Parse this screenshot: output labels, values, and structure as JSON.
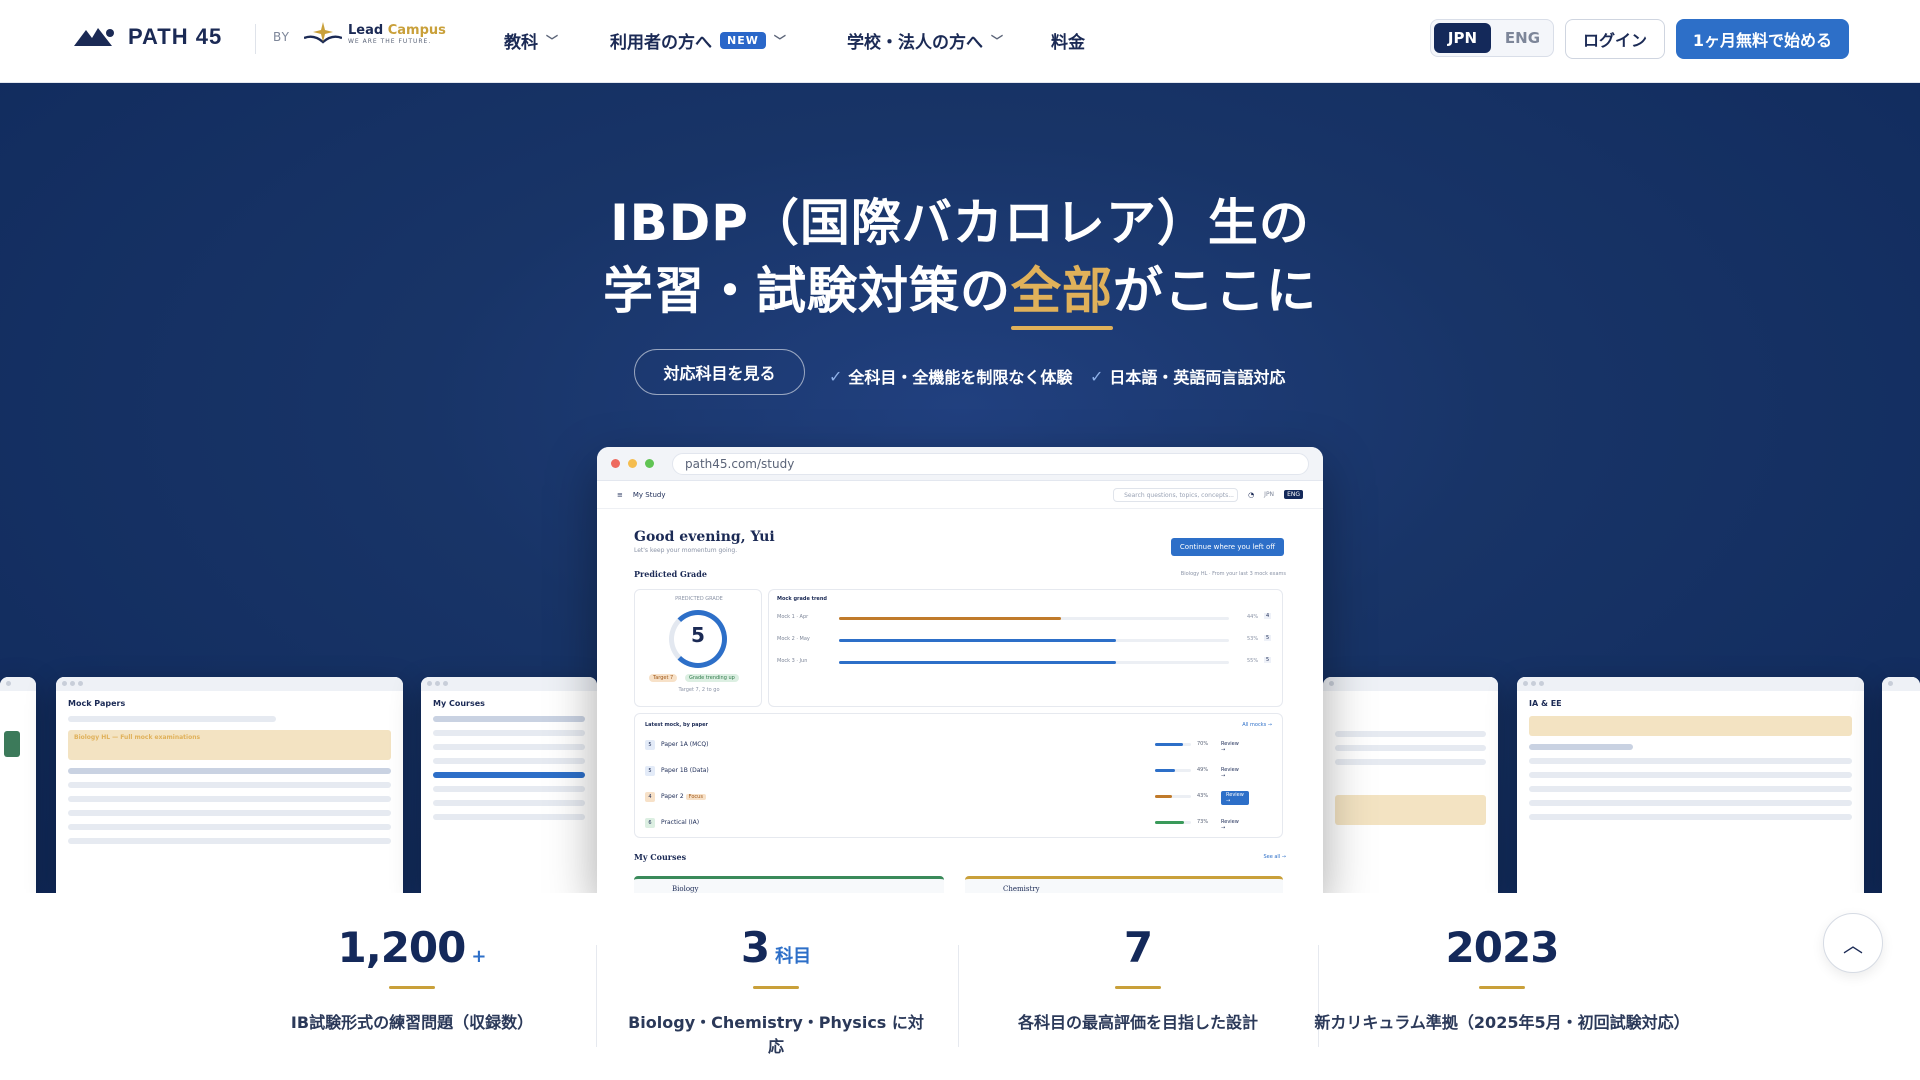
{
  "header": {
    "brand": "PATH 45",
    "by": "BY",
    "partner_line1a": "Lead",
    "partner_line1b": "Campus",
    "partner_line2": "WE ARE THE FUTURE.",
    "nav": [
      {
        "label": "教科"
      },
      {
        "label": "利用者の方へ",
        "badge": "NEW"
      },
      {
        "label": "学校・法人の方へ"
      },
      {
        "label": "料金"
      }
    ],
    "lang_active": "JPN",
    "lang_other": "ENG",
    "login": "ログイン",
    "cta": "1ヶ月無料で始める"
  },
  "hero": {
    "line1": "IBDP（国際バカロレア）生の",
    "line2_pre": "学習・試験対策の",
    "line2_highlight": "全部",
    "line2_post": "がここに",
    "button": "対応科目を見る",
    "check1": "全科目・全機能を制限なく体験",
    "check2": "日本語・英語両言語対応",
    "check_icon": "✓"
  },
  "app": {
    "url": "path45.com/study",
    "menu": "My Study",
    "search_placeholder": "Search questions, topics, concepts...",
    "lang_jp": "JPN",
    "lang_en": "ENG",
    "greeting": "Good evening, Yui",
    "greeting_sub": "Let's keep your momentum going.",
    "continue": "Continue where you left off",
    "predicted_grade_title": "Predicted Grade",
    "predicted_grade_note": "Biology HL · From your last 3 mock exams",
    "pg_label": "PREDICTED GRADE",
    "pg_value": "5",
    "pg_target_pill": "Target 7",
    "pg_trend_pill": "Grade trending up",
    "pg_target_note": "Target 7, 2 to go",
    "trend_title": "Mock grade trend",
    "trend_rows": [
      {
        "label": "Mock 1 · Apr",
        "pct": "44%",
        "grade": "4",
        "fill": 0.57,
        "color": "#c07a2a"
      },
      {
        "label": "Mock 2 · May",
        "pct": "53%",
        "grade": "5",
        "fill": 0.71,
        "color": "#2d6fc8"
      },
      {
        "label": "Mock 3 · Jun",
        "pct": "55%",
        "grade": "5",
        "fill": 0.71,
        "color": "#2d6fc8"
      }
    ],
    "latest_title": "Latest mock, by paper",
    "latest_link": "All mocks →",
    "papers": [
      {
        "n": "5",
        "name": "Paper 1A (MCQ)",
        "pct": "70%",
        "fill": 0.78,
        "color": "#2d6fc8",
        "review": "Review →",
        "hl": false
      },
      {
        "n": "5",
        "name": "Paper 1B (Data)",
        "pct": "49%",
        "fill": 0.55,
        "color": "#2d6fc8",
        "review": "Review →",
        "hl": false
      },
      {
        "n": "4",
        "name": "Paper 2",
        "tag": "Focus",
        "pct": "43%",
        "fill": 0.48,
        "color": "#c07a2a",
        "review": "Review →",
        "hl": true
      },
      {
        "n": "6",
        "name": "Practical (IA)",
        "pct": "73%",
        "fill": 0.8,
        "color": "#3a9a5a",
        "review": "Review →",
        "hl": false
      }
    ],
    "courses_title": "My Courses",
    "courses_link": "See all →",
    "course1": "Biology",
    "course2": "Chemistry"
  },
  "side_screens": {
    "mock_papers": "Mock Papers",
    "mock_banner": "Biology HL — Full mock examinations",
    "my_courses": "My Courses",
    "ia_ee": "IA & EE"
  },
  "stats": [
    {
      "num": "1,200",
      "suf": "+",
      "cap": "IB試験形式の練習問題（収録数）"
    },
    {
      "num": "3",
      "suf": "科目",
      "cap": "Biology・Chemistry・Physics に対応"
    },
    {
      "num": "7",
      "suf": "",
      "cap": "各科目の最高評価を目指した設計"
    },
    {
      "num": "2023",
      "suf": "",
      "cap": "新カリキュラム準拠（2025年5月・初回試験対応）"
    }
  ],
  "colors": {
    "navy": "#14295a",
    "accent": "#2d6fc8",
    "gold": "#e0b15a"
  },
  "icons": {
    "chevron": "chevron-down-icon",
    "to_top": "chevron-up-icon"
  }
}
